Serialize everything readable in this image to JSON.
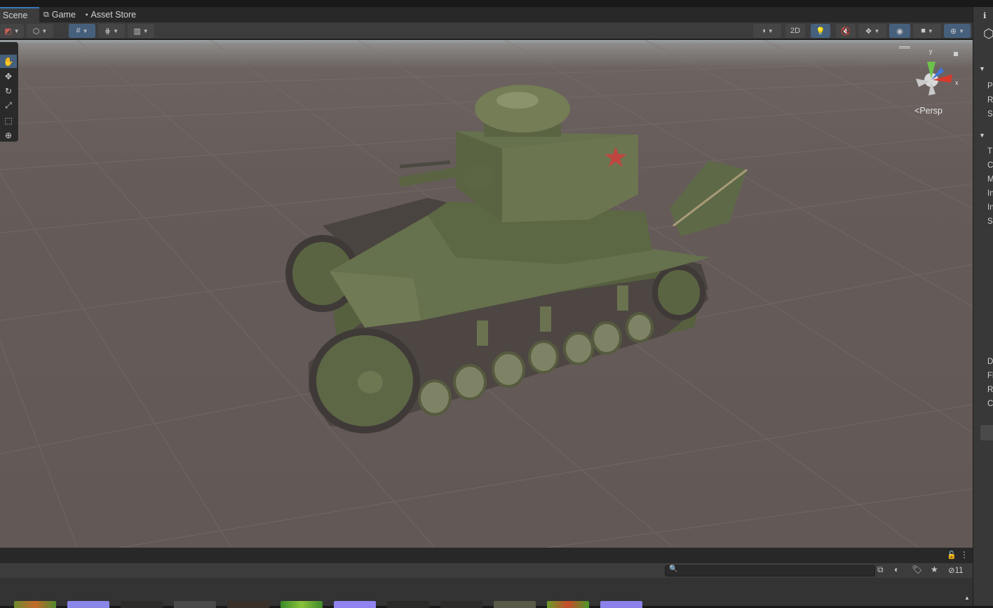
{
  "tabs": [
    {
      "label": "Scene",
      "icon": "scene-icon"
    },
    {
      "label": "Game",
      "icon": "gamepad-icon"
    },
    {
      "label": "Asset Store",
      "icon": "store-icon"
    }
  ],
  "toolbar": {
    "toggle_2d_label": "2D"
  },
  "scene_view": {
    "projection_label": "Persp",
    "gizmo_axes": {
      "y": "y",
      "x": "x"
    },
    "model": "green WWII-era light tank with red star on turret"
  },
  "tools": [
    "hand-tool",
    "move-tool",
    "rotate-tool",
    "scale-tool",
    "rect-tool",
    "transform-tool"
  ],
  "inspector_partial": {
    "rows_a": [
      "P",
      "R",
      "S"
    ],
    "rows_b": [
      "T",
      "C",
      "M",
      "In",
      "In",
      "S"
    ],
    "rows_c": [
      "D",
      "Fl",
      "R",
      "C"
    ]
  },
  "project_bar": {
    "search_placeholder": "",
    "hidden_count": "11"
  },
  "colors": {
    "accent": "#3a79bb",
    "active_button": "#46607c",
    "tank_green": "#5e6a45",
    "star": "#c0453e"
  }
}
